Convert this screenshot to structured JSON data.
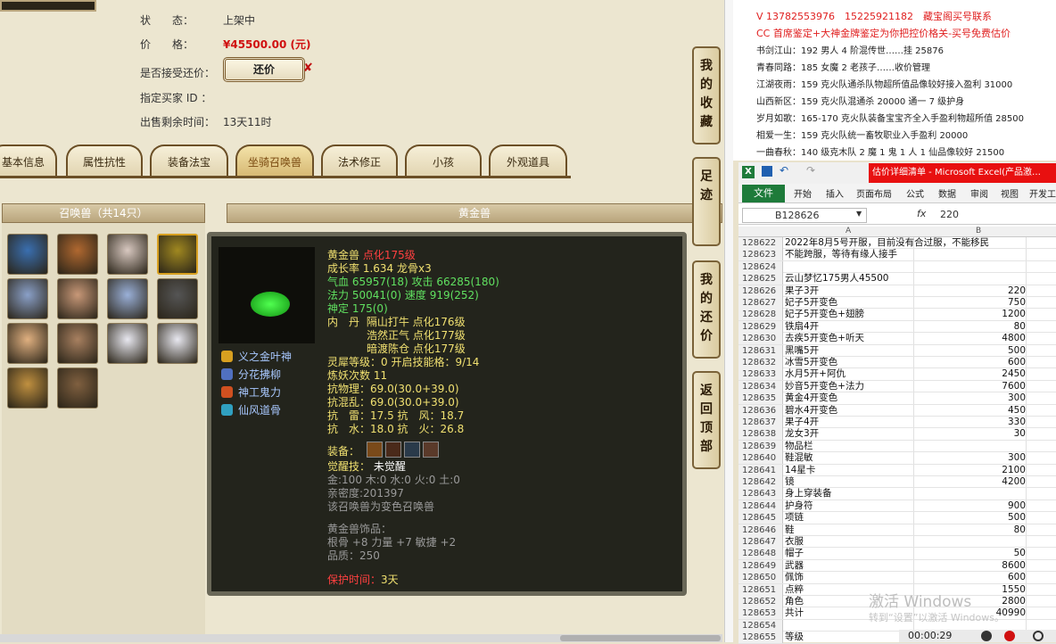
{
  "listing": {
    "status_label": "状　　态：",
    "status_value": "上架中",
    "price_label": "价　　格：",
    "price_value": "¥45500.00 (元)",
    "counter_label": "是否接受还价：",
    "counter_button": "还价",
    "counter_x": "✘",
    "buyer_label": "指定买家 ID ：",
    "remaining_label": "出售剩余时间：",
    "remaining_value": "13天11时"
  },
  "tabs": [
    "基本信息",
    "属性抗性",
    "装备法宝",
    "坐骑召唤兽",
    "法术修正",
    "小孩",
    "外观道具"
  ],
  "active_tab": "坐骑召唤兽",
  "pets_panel": {
    "title": "召唤兽（共14只）",
    "pet_colors": [
      "#3a6fb0",
      "#b06830",
      "#d8c8c0",
      "#a08820",
      "#8aa0c8",
      "#c89878",
      "#9ab0d8",
      "#555",
      "#e0b080",
      "#a88060",
      "#e8e8f0",
      "#e8e8f0",
      "#c09040",
      "#806040"
    ]
  },
  "detail_panel": {
    "title": "黄金兽",
    "name": "黄金兽",
    "rank": "点化175级",
    "growth": "成长率 1.634 龙骨x3",
    "hp_label": "气血",
    "hp": "65957(18)",
    "atk_label": "攻击",
    "atk": "66285(180)",
    "mp_label": "法力",
    "mp": "50041(0)",
    "spd_label": "速度",
    "spd": "919(252)",
    "god_label": "神定",
    "god": "175(0)",
    "inner_label": "内　丹",
    "inner1": "隔山打牛 点化176级",
    "inner2": "浩然正气 点化177级",
    "inner3": "暗渡陈仓 点化177级",
    "spirit": "灵犀等级：0 开启技能格：9/14",
    "refine": "炼妖次数 11",
    "res_phys": "抗物理：69.0(30.0+39.0)",
    "res_chaos": "抗混乱：69.0(30.0+39.0)",
    "res_thunder": "抗　雷：17.5 抗　风：18.7",
    "res_water": "抗　水：18.0 抗　火：26.8",
    "equip_label": "装备：",
    "awaken_label": "觉醒技：",
    "awaken_value": "未觉醒",
    "elements": "金:100 木:0 水:0 火:0 土:0",
    "intimacy": "亲密度:201397",
    "transform": "该召唤兽为变色召唤兽",
    "ornament_title": "黄金兽饰品：",
    "ornament_stats": "根骨 +8 力量 +7 敏捷 +2",
    "ornament_quality": "品质：250",
    "protect_label": "保护时间：",
    "protect_value": "3天"
  },
  "skills": [
    {
      "name": "义之金叶神",
      "color": "#d8a020"
    },
    {
      "name": "分花拂柳",
      "color": "#5070c0"
    },
    {
      "name": "神工鬼力",
      "color": "#d05020"
    },
    {
      "name": "仙风道骨",
      "color": "#30a0c0"
    }
  ],
  "side_buttons": [
    {
      "label": "我的收藏"
    },
    {
      "label": "足迹"
    },
    {
      "label": "我的还价"
    },
    {
      "label": "返回顶部"
    }
  ],
  "notes": [
    {
      "text": "V 13782553976　15225921182　藏宝阁买号联系",
      "color": "#e02020"
    },
    {
      "text": "CC 首席鉴定+大神金牌鉴定为你把控价格关-买号免费估价",
      "color": "#e02020"
    },
    {
      "text": "书剑江山：192 男人 4 阶混传世……挂 25876",
      "color": "#222"
    },
    {
      "text": "青春同路：185 女魔 2 老孩子……收价管理",
      "color": "#222"
    },
    {
      "text": "江湖夜雨：159 克火队通杀队物超所值品像较好接入盈利 31000",
      "color": "#222"
    },
    {
      "text": "山西新区：159 克火队混通杀 20000 通一 7 级护身",
      "color": "#222"
    },
    {
      "text": "岁月如歌：165-170 克火队装备宝宝齐全入手盈利物超所值 28500",
      "color": "#222"
    },
    {
      "text": "相爱一生：159 克火队统一畜牧职业入手盈利 20000",
      "color": "#222"
    },
    {
      "text": "一曲春秋：140 级克木队 2 魔 1 鬼 1 人 1 仙品像较好 21500",
      "color": "#222"
    }
  ],
  "excel": {
    "title": "估价详细清单 - Microsoft Excel(产品激…",
    "ribbon_tabs": [
      "开始",
      "插入",
      "页面布局",
      "公式",
      "数据",
      "审阅",
      "视图",
      "开发工"
    ],
    "file_tab": "文件",
    "name_box": "B128626",
    "fx": "fx",
    "formula_value": "220",
    "col_a": "A",
    "col_b": "B",
    "rows": [
      {
        "n": "128622",
        "a": "2022年8月5号开服，目前没有合过服，不能移民",
        "b": ""
      },
      {
        "n": "128623",
        "a": "不能跨服，等待有缘人接手",
        "b": ""
      },
      {
        "n": "128624",
        "a": "",
        "b": ""
      },
      {
        "n": "128625",
        "a": "云山梦忆175男人45500",
        "b": ""
      },
      {
        "n": "128626",
        "a": "果子3开",
        "b": "220"
      },
      {
        "n": "128627",
        "a": "妃子5开变色",
        "b": "750"
      },
      {
        "n": "128628",
        "a": "妃子5开变色+翅膀",
        "b": "1200"
      },
      {
        "n": "128629",
        "a": "铁扇4开",
        "b": "80"
      },
      {
        "n": "128630",
        "a": "去疾5开变色+听天",
        "b": "4800"
      },
      {
        "n": "128631",
        "a": "黑嘴5开",
        "b": "500"
      },
      {
        "n": "128632",
        "a": "冰雪5开变色",
        "b": "600"
      },
      {
        "n": "128633",
        "a": "水月5开+阿仇",
        "b": "2450"
      },
      {
        "n": "128634",
        "a": "妙音5开变色+法力",
        "b": "7600"
      },
      {
        "n": "128635",
        "a": "黄金4开变色",
        "b": "300"
      },
      {
        "n": "128636",
        "a": "碧水4开变色",
        "b": "450"
      },
      {
        "n": "128637",
        "a": "果子4开",
        "b": "330"
      },
      {
        "n": "128638",
        "a": "龙女3开",
        "b": "30"
      },
      {
        "n": "128639",
        "a": "物品栏",
        "b": ""
      },
      {
        "n": "128640",
        "a": "鞋混敏",
        "b": "300"
      },
      {
        "n": "128641",
        "a": "14星卡",
        "b": "2100"
      },
      {
        "n": "128642",
        "a": "镜",
        "b": "4200"
      },
      {
        "n": "128643",
        "a": "身上穿装备",
        "b": ""
      },
      {
        "n": "128644",
        "a": "护身符",
        "b": "900"
      },
      {
        "n": "128645",
        "a": "项链",
        "b": "500"
      },
      {
        "n": "128646",
        "a": "鞋",
        "b": "80"
      },
      {
        "n": "128647",
        "a": "衣服",
        "b": ""
      },
      {
        "n": "128648",
        "a": "帽子",
        "b": "50"
      },
      {
        "n": "128649",
        "a": "武器",
        "b": "8600"
      },
      {
        "n": "128650",
        "a": "佩饰",
        "b": "600"
      },
      {
        "n": "128651",
        "a": "点粹",
        "b": "1550"
      },
      {
        "n": "128652",
        "a": "角色",
        "b": "2800"
      },
      {
        "n": "128653",
        "a": "共计",
        "b": "40990"
      },
      {
        "n": "128654",
        "a": "",
        "b": ""
      },
      {
        "n": "128655",
        "a": "等级",
        "b": ""
      }
    ]
  },
  "watermark": "激活 Windows",
  "watermark_sub": "转到“设置”以激活 Windows。",
  "timer": "00:00:29"
}
